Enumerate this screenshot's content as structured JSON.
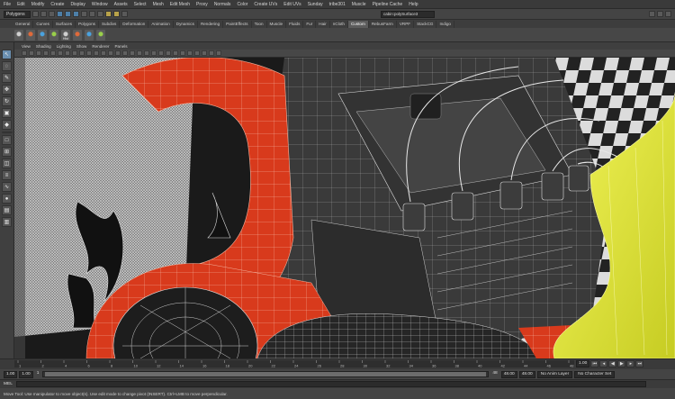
{
  "menubar": {
    "items": [
      "File",
      "Edit",
      "Modify",
      "Create",
      "Display",
      "Window",
      "Assets",
      "Select",
      "Mesh",
      "Edit Mesh",
      "Proxy",
      "Normals",
      "Color",
      "Create UVs",
      "Edit UVs",
      "Sunday",
      "tribe301",
      "Muscle",
      "Pipeline Cache",
      "Help"
    ]
  },
  "statusline": {
    "mode": "Polygons",
    "selection_field": "cabin:polySurface3"
  },
  "shelf": {
    "tabs": [
      "General",
      "Curves",
      "Surfaces",
      "Polygons",
      "Subdivs",
      "Deformation",
      "Animation",
      "Dynamics",
      "Rendering",
      "PaintEffects",
      "Toon",
      "Muscle",
      "Fluids",
      "Fur",
      "Hair",
      "nCloth",
      "Custom",
      "RebusFarm",
      "VRPF",
      "StackCG",
      "Indigo"
    ],
    "active_tab": "Custom",
    "icon_labels": [
      "",
      "",
      "",
      "",
      "Hist",
      "",
      "",
      ""
    ]
  },
  "panel": {
    "menus": [
      "View",
      "Shading",
      "Lighting",
      "Show",
      "Renderer",
      "Panels"
    ]
  },
  "colors": {
    "fender_red": "#d83a1c",
    "checker_light": "#dcdcdc",
    "checker_dark": "#222222",
    "engine_gray": "#3a3a3a",
    "yellow_glass": "#e6ec3c",
    "wire_white": "#f0f0f0",
    "toolbox_active": "#6a8fb0"
  },
  "timeline": {
    "ticks": [
      "1",
      "2",
      "4",
      "6",
      "8",
      "10",
      "12",
      "14",
      "16",
      "18",
      "20",
      "22",
      "24",
      "26",
      "28",
      "30",
      "32",
      "34",
      "36",
      "38",
      "40",
      "42",
      "44",
      "46",
      "48"
    ],
    "current_frame": "1.00"
  },
  "range": {
    "start": "1.00",
    "start_inner": "1.00",
    "slider_value": "1",
    "end_inner": "48",
    "end": "48.00",
    "end_outer": "48.00",
    "anim_layer": "No Anim Layer",
    "character_set": "No Character Set"
  },
  "mel": {
    "label": "MEL"
  },
  "help": {
    "text": "Move Tool: Use manipulator to move object(s). Use edit mode to change pivot (INSERT). Ctrl+LMB to move perpendicular."
  },
  "toolbox": {
    "tools": [
      "select-tool",
      "lasso-tool",
      "paint-tool",
      "move-tool",
      "rotate-tool",
      "scale-tool",
      "manip-tool",
      "last-tool"
    ]
  }
}
